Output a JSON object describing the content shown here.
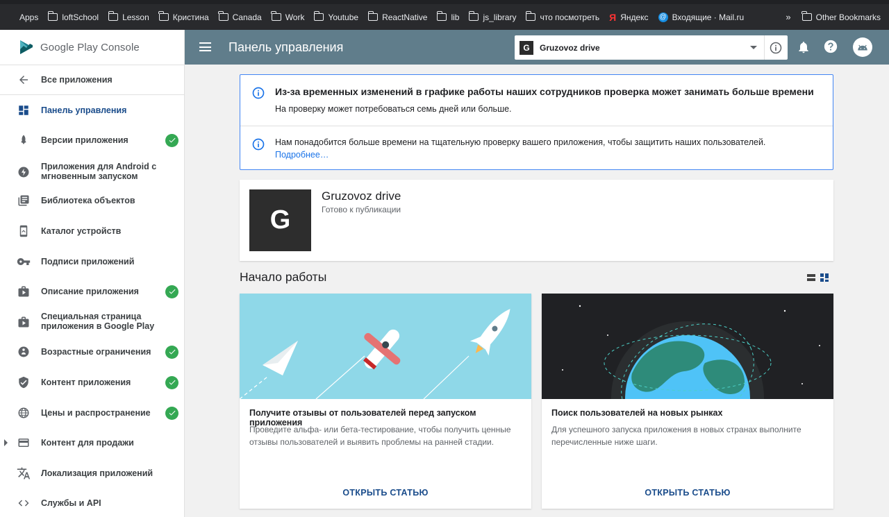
{
  "bookmarks": [
    {
      "label": "Apps",
      "icon": "apps-grid-icon"
    },
    {
      "label": "loftSchool",
      "icon": "folder-icon"
    },
    {
      "label": "Lesson",
      "icon": "folder-icon"
    },
    {
      "label": "Кристина",
      "icon": "folder-icon"
    },
    {
      "label": "Canada",
      "icon": "folder-icon"
    },
    {
      "label": "Work",
      "icon": "folder-icon"
    },
    {
      "label": "Youtube",
      "icon": "folder-icon"
    },
    {
      "label": "ReactNative",
      "icon": "folder-icon"
    },
    {
      "label": "lib",
      "icon": "folder-icon"
    },
    {
      "label": "js_library",
      "icon": "folder-icon"
    },
    {
      "label": "что посмотреть",
      "icon": "folder-icon"
    },
    {
      "label": "Яндекс",
      "icon": "yandex-icon"
    },
    {
      "label": "Входящие · Mail.ru",
      "icon": "mail-icon"
    }
  ],
  "bookmarks_more": "»",
  "other_bookmarks": "Other Bookmarks",
  "logo": {
    "text": "Google Play Console"
  },
  "sidebar": {
    "back_label": "Все приложения",
    "items": [
      {
        "label": "Панель управления",
        "active": true,
        "done": false
      },
      {
        "label": "Версии приложения",
        "done": true
      },
      {
        "label": "Приложения для Android с мгновенным запуском",
        "done": false
      },
      {
        "label": "Библиотека объектов",
        "done": false
      },
      {
        "label": "Каталог устройств",
        "done": false
      },
      {
        "label": "Подписи приложений",
        "done": false
      },
      {
        "label": "Описание приложения",
        "done": true
      },
      {
        "label": "Специальная страница приложения в Google Play",
        "done": false
      },
      {
        "label": "Возрастные ограничения",
        "done": true
      },
      {
        "label": "Контент приложения",
        "done": true
      },
      {
        "label": "Цены и распространение",
        "done": true
      },
      {
        "label": "Контент для продажи",
        "done": false
      },
      {
        "label": "Локализация приложений",
        "done": false
      },
      {
        "label": "Службы и API",
        "done": false
      }
    ]
  },
  "header": {
    "title": "Панель управления",
    "app_selector": {
      "letter": "G",
      "name": "Gruzovoz drive"
    }
  },
  "notice": {
    "title": "Из-за временных изменений в графике работы наших сотрудников проверка может занимать больше времени",
    "subtitle": "На проверку может потребоваться семь дней или больше.",
    "text2": "Нам понадобится больше времени на тщательную проверку вашего приложения, чтобы защитить наших пользователей.",
    "link": "Подробнее…"
  },
  "app": {
    "letter": "G",
    "name": "Gruzovoz drive",
    "status": "Готово к публикации"
  },
  "getting_started": {
    "title": "Начало работы",
    "cards": [
      {
        "title": "Получите отзывы от пользователей перед запуском приложения",
        "desc": "Проведите альфа- или бета-тестирование, чтобы получить ценные отзывы пользователей и выявить проблемы на ранней стадии.",
        "button": "ОТКРЫТЬ СТАТЬЮ"
      },
      {
        "title": "Поиск пользователей на новых рынках",
        "desc": "Для успешного запуска приложения в новых странах выполните перечисленные ниже шаги.",
        "button": "ОТКРЫТЬ СТАТЬЮ"
      }
    ]
  },
  "colors": {
    "header": "#607d8b",
    "active_nav": "#1a4c8b",
    "check": "#34a853",
    "notice_border": "#4285f4"
  }
}
